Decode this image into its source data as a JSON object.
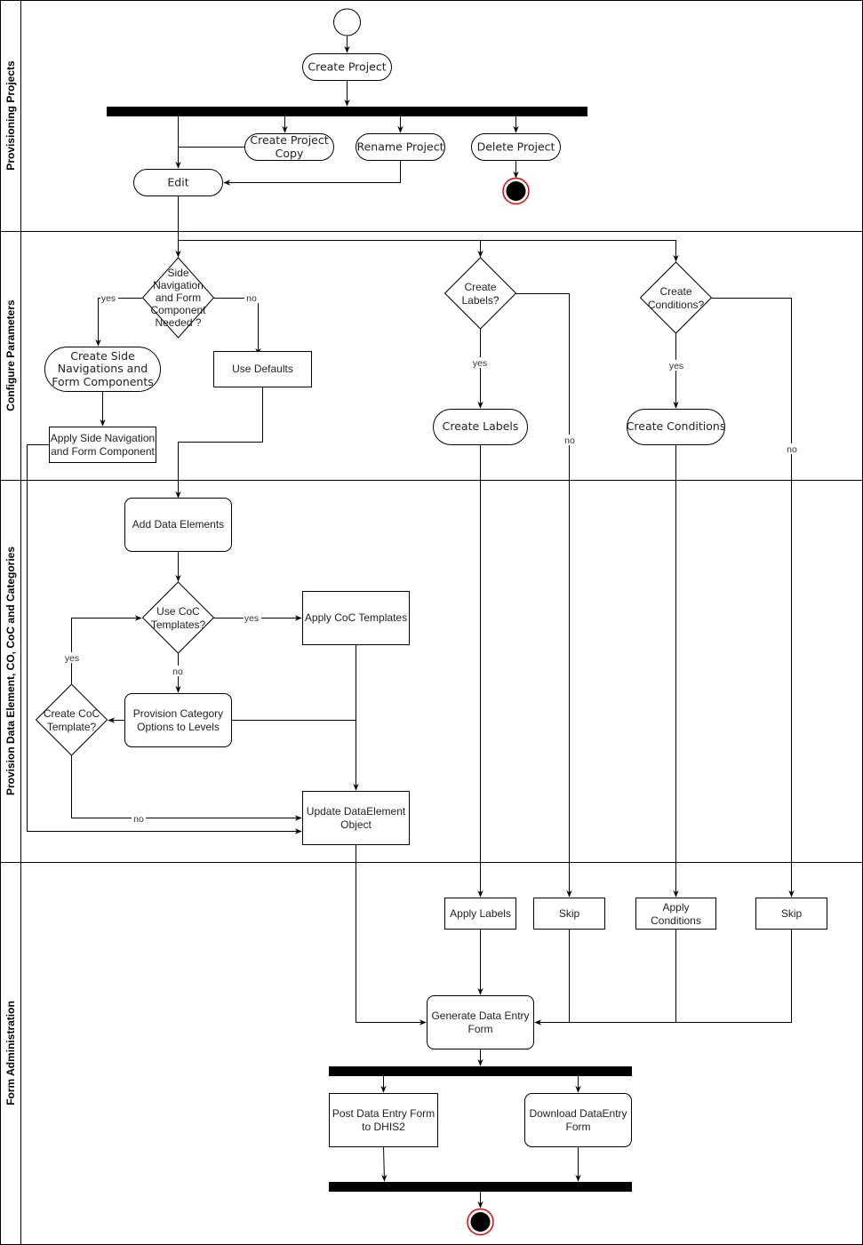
{
  "lanes": [
    {
      "id": "lane1",
      "label": "Provisioning Projects"
    },
    {
      "id": "lane2",
      "label": "Configure Parameters"
    },
    {
      "id": "lane3",
      "label": "Provision Data Element, CO, CoC and Categories"
    },
    {
      "id": "lane4",
      "label": "Form Administration"
    }
  ],
  "nodes": {
    "create_project": "Create Project",
    "create_project_copy": [
      "Create Project",
      "Copy"
    ],
    "rename_project": "Rename Project",
    "delete_project": "Delete Project",
    "edit": "Edit",
    "side_nav_decision": [
      "Side",
      "Navigation",
      "and Form",
      "Component",
      "Needed ?"
    ],
    "create_side_nav": [
      "Create Side",
      "Navigations and",
      "Form Components"
    ],
    "use_defaults": "Use Defaults",
    "apply_side_nav": [
      "Apply Side Navigation",
      "and Form Component"
    ],
    "create_labels_decision": [
      "Create",
      "Labels?"
    ],
    "create_labels": "Create Labels",
    "create_conditions_decision": [
      "Create",
      "Conditions?"
    ],
    "create_conditions": "Create Conditions",
    "add_data_elements": "Add Data Elements",
    "use_coc_decision": [
      "Use CoC",
      "Templates?"
    ],
    "apply_coc": "Apply CoC Templates",
    "provision_category": [
      "Provision Category",
      "Options to Levels"
    ],
    "create_coc_decision": [
      "Create CoC",
      "Template?"
    ],
    "update_dataelement": [
      "Update DataElement",
      "Object"
    ],
    "apply_labels": "Apply Labels",
    "skip1": "Skip",
    "apply_conditions": [
      "Apply",
      "Conditions"
    ],
    "skip2": "Skip",
    "generate_form": [
      "Generate Data Entry",
      "Form"
    ],
    "post_form": [
      "Post Data Entry Form",
      "to DHIS2"
    ],
    "download_form": [
      "Download DataEntry",
      "Form"
    ]
  },
  "edge_labels": {
    "yes": "yes",
    "no": "no"
  }
}
